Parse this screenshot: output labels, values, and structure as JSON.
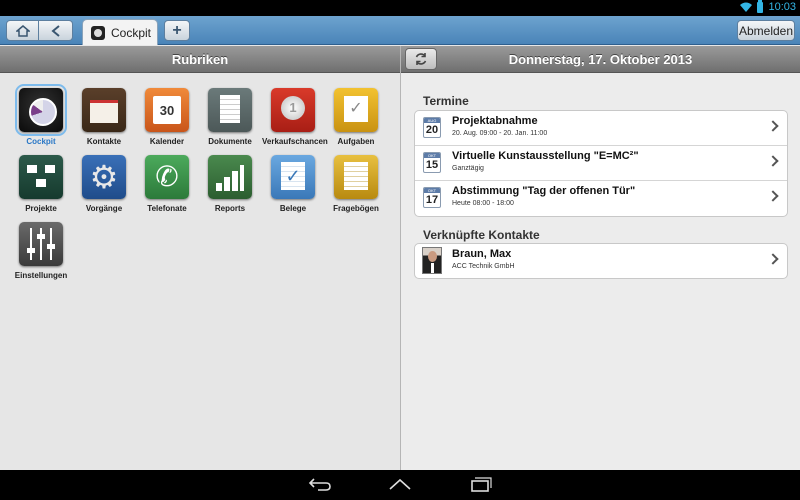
{
  "statusbar": {
    "clock": "10:03"
  },
  "toolbar": {
    "tab_label": "Cockpit",
    "plus_label": "+",
    "logout_label": "Abmelden"
  },
  "left": {
    "header": "Rubriken",
    "apps": [
      {
        "label": "Cockpit",
        "icon": "cockpit-icon"
      },
      {
        "label": "Kontakte",
        "icon": "contacts-icon"
      },
      {
        "label": "Kalender",
        "icon": "calendar-icon",
        "badge": "30"
      },
      {
        "label": "Dokumente",
        "icon": "documents-icon"
      },
      {
        "label": "Verkaufschancen",
        "icon": "sales-opportunity-icon"
      },
      {
        "label": "Aufgaben",
        "icon": "tasks-icon"
      },
      {
        "label": "Projekte",
        "icon": "projects-icon"
      },
      {
        "label": "Vorgänge",
        "icon": "processes-icon"
      },
      {
        "label": "Telefonate",
        "icon": "phone-calls-icon"
      },
      {
        "label": "Reports",
        "icon": "reports-icon"
      },
      {
        "label": "Belege",
        "icon": "receipts-icon"
      },
      {
        "label": "Fragebögen",
        "icon": "questionnaires-icon"
      },
      {
        "label": "Einstellungen",
        "icon": "settings-icon"
      }
    ]
  },
  "right": {
    "header": "Donnerstag, 17. Oktober 2013",
    "termine_title": "Termine",
    "termine": [
      {
        "month": "AUG",
        "day": "20",
        "title": "Projektabnahme",
        "sub": "20. Aug. 09:00 - 20. Jan. 11:00"
      },
      {
        "month": "OKT",
        "day": "15",
        "title": "Virtuelle Kunstausstellung \"E=MC²\"",
        "sub": "Ganztägig"
      },
      {
        "month": "OKT",
        "day": "17",
        "title": "Abstimmung \"Tag der offenen Tür\"",
        "sub": "Heute 08:00 - 18:00"
      }
    ],
    "kontakte_title": "Verknüpfte Kontakte",
    "kontakte": [
      {
        "name": "Braun, Max",
        "company": "ACC Technik GmbH"
      }
    ]
  },
  "colors": {
    "accent": "#33b5e5",
    "toolbar": "#4a84b8",
    "selected_label": "#2a78c6"
  }
}
